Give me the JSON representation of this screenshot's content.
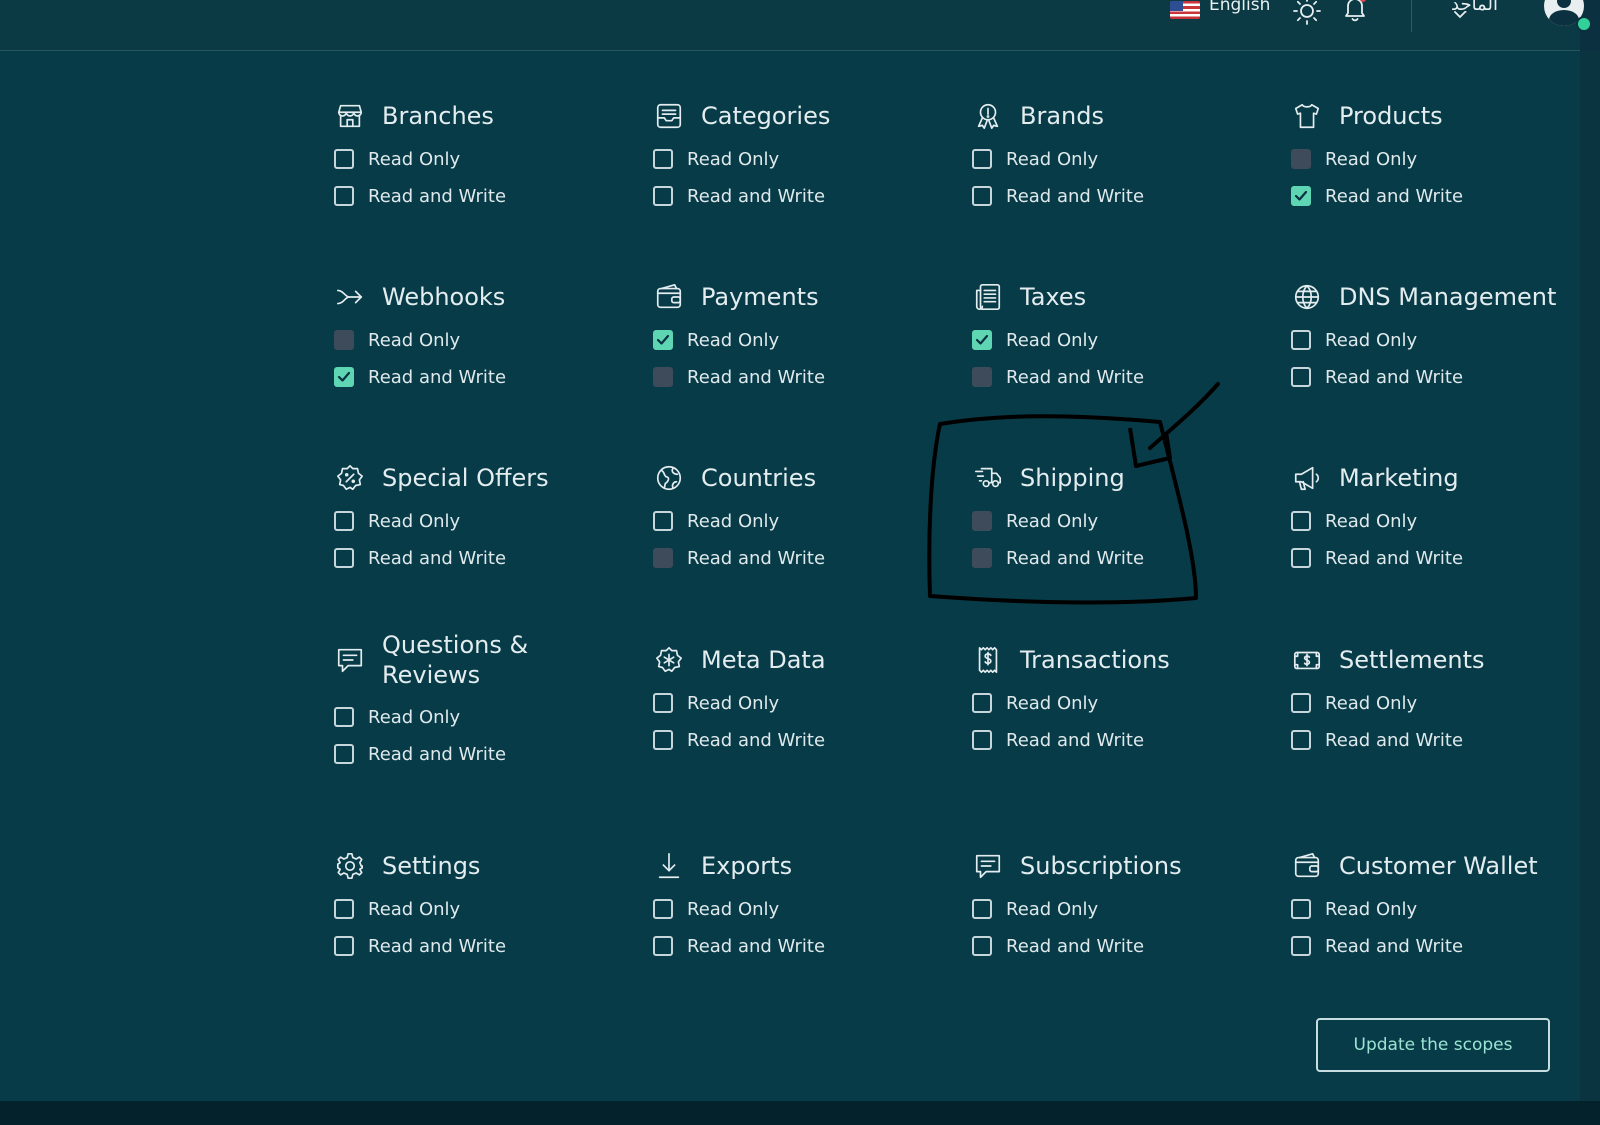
{
  "header": {
    "language": "English",
    "user_name": "الماجد",
    "icons": [
      "us-flag-icon",
      "sun-icon",
      "bell-icon",
      "chevron-down-icon",
      "avatar-icon"
    ]
  },
  "scopes": [
    {
      "title": "Branches",
      "icon": "store-icon",
      "read_only": "Read Only",
      "read_write": "Read and Write",
      "ro_state": "unchecked",
      "rw_state": "unchecked"
    },
    {
      "title": "Categories",
      "icon": "inbox-tray-icon",
      "read_only": "Read Only",
      "read_write": "Read and Write",
      "ro_state": "unchecked",
      "rw_state": "unchecked"
    },
    {
      "title": "Brands",
      "icon": "award-badge-icon",
      "read_only": "Read Only",
      "read_write": "Read and Write",
      "ro_state": "unchecked",
      "rw_state": "unchecked"
    },
    {
      "title": "Products",
      "icon": "tshirt-icon",
      "read_only": "Read Only",
      "read_write": "Read and Write",
      "ro_state": "disabled",
      "rw_state": "checked"
    },
    {
      "title": "Webhooks",
      "icon": "webhook-arrow-icon",
      "read_only": "Read Only",
      "read_write": "Read and Write",
      "ro_state": "disabled",
      "rw_state": "checked"
    },
    {
      "title": "Payments",
      "icon": "wallet-icon",
      "read_only": "Read Only",
      "read_write": "Read and Write",
      "ro_state": "checked",
      "rw_state": "disabled"
    },
    {
      "title": "Taxes",
      "icon": "receipt-list-icon",
      "read_only": "Read Only",
      "read_write": "Read and Write",
      "ro_state": "checked",
      "rw_state": "disabled"
    },
    {
      "title": "DNS Management",
      "icon": "globe-icon",
      "read_only": "Read Only",
      "read_write": "Read and Write",
      "ro_state": "unchecked",
      "rw_state": "unchecked"
    },
    {
      "title": "Special Offers",
      "icon": "discount-badge-icon",
      "read_only": "Read Only",
      "read_write": "Read and Write",
      "ro_state": "unchecked",
      "rw_state": "unchecked"
    },
    {
      "title": "Countries",
      "icon": "globe-map-icon",
      "read_only": "Read Only",
      "read_write": "Read and Write",
      "ro_state": "unchecked",
      "rw_state": "disabled"
    },
    {
      "title": "Shipping",
      "icon": "delivery-truck-icon",
      "read_only": "Read Only",
      "read_write": "Read and Write",
      "ro_state": "disabled",
      "rw_state": "disabled"
    },
    {
      "title": "Marketing",
      "icon": "megaphone-icon",
      "read_only": "Read Only",
      "read_write": "Read and Write",
      "ro_state": "unchecked",
      "rw_state": "unchecked"
    },
    {
      "title": "Questions & Reviews",
      "icon": "message-square-icon",
      "read_only": "Read Only",
      "read_write": "Read and Write",
      "ro_state": "unchecked",
      "rw_state": "unchecked"
    },
    {
      "title": "Meta Data",
      "icon": "star-shield-icon",
      "read_only": "Read Only",
      "read_write": "Read and Write",
      "ro_state": "unchecked",
      "rw_state": "unchecked"
    },
    {
      "title": "Transactions",
      "icon": "receipt-dollar-icon",
      "read_only": "Read Only",
      "read_write": "Read and Write",
      "ro_state": "unchecked",
      "rw_state": "unchecked"
    },
    {
      "title": "Settlements",
      "icon": "cash-note-icon",
      "read_only": "Read Only",
      "read_write": "Read and Write",
      "ro_state": "unchecked",
      "rw_state": "unchecked"
    },
    {
      "title": "Settings",
      "icon": "gear-icon",
      "read_only": "Read Only",
      "read_write": "Read and Write",
      "ro_state": "unchecked",
      "rw_state": "unchecked"
    },
    {
      "title": "Exports",
      "icon": "download-icon",
      "read_only": "Read Only",
      "read_write": "Read and Write",
      "ro_state": "unchecked",
      "rw_state": "unchecked"
    },
    {
      "title": "Subscriptions",
      "icon": "message-square-icon",
      "read_only": "Read Only",
      "read_write": "Read and Write",
      "ro_state": "unchecked",
      "rw_state": "unchecked"
    },
    {
      "title": "Customer Wallet",
      "icon": "wallet-icon",
      "read_only": "Read Only",
      "read_write": "Read and Write",
      "ro_state": "unchecked",
      "rw_state": "unchecked"
    }
  ],
  "actions": {
    "update_label": "Update the scopes"
  },
  "colors": {
    "background": "#073b48",
    "header": "#0b3944",
    "accent": "#5ed6b4",
    "disabled": "#3e4b5a",
    "text": "#e3ecee"
  }
}
